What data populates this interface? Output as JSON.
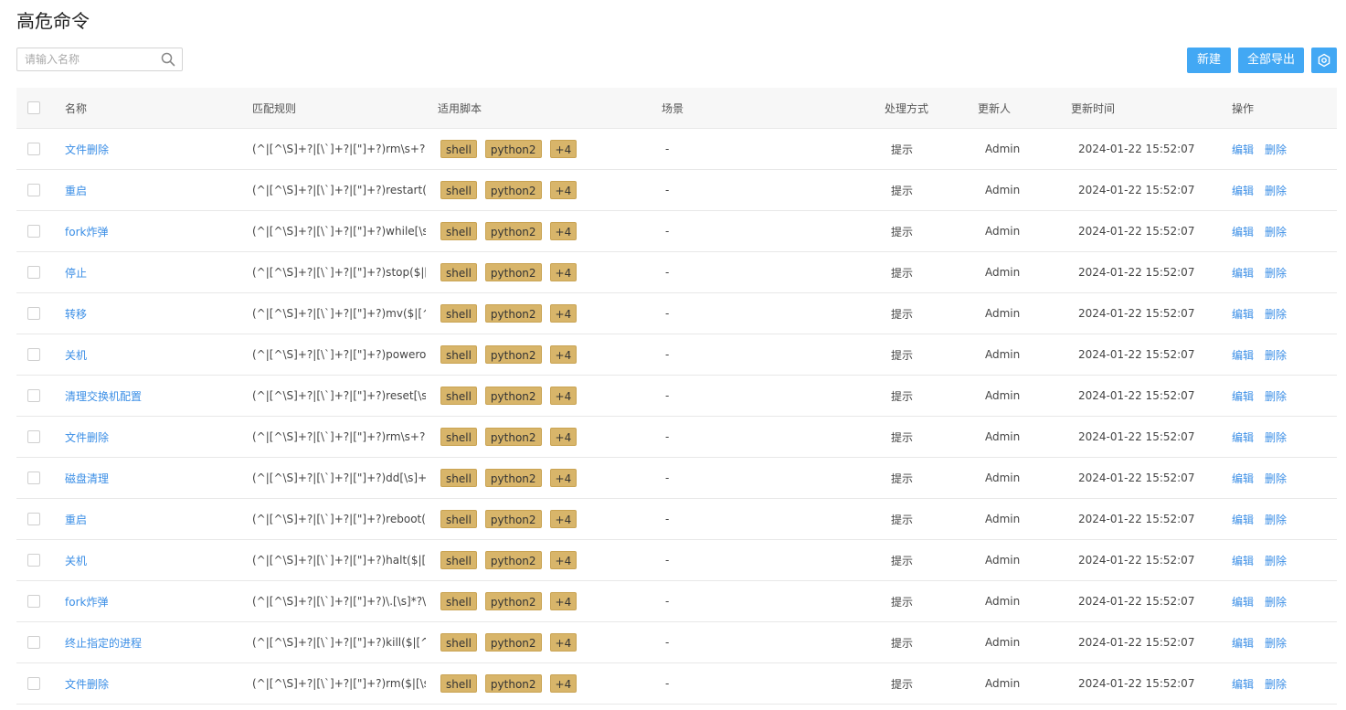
{
  "page": {
    "title": "高危命令"
  },
  "search": {
    "placeholder": "请输入名称"
  },
  "toolbar": {
    "new_label": "新建",
    "export_label": "全部导出",
    "settings_icon": "settings-icon"
  },
  "table": {
    "columns": [
      "名称",
      "匹配规则",
      "适用脚本",
      "场景",
      "处理方式",
      "更新人",
      "更新时间",
      "操作"
    ],
    "ops": {
      "edit": "编辑",
      "delete": "删除"
    },
    "rows": [
      {
        "name": "文件删除",
        "rule": "(^|[^\\S]+?|[\\`]+?|[\"]+?)rm\\s+?-[rf...",
        "tags": [
          "shell",
          "python2",
          "+4"
        ],
        "scene": "-",
        "handle": "提示",
        "user": "Admin",
        "time": "2024-01-22 15:52:07"
      },
      {
        "name": "重启",
        "rule": "(^|[^\\S]+?|[\\`]+?|[\"]+?)restart($|[...",
        "tags": [
          "shell",
          "python2",
          "+4"
        ],
        "scene": "-",
        "handle": "提示",
        "user": "Admin",
        "time": "2024-01-22 15:52:07"
      },
      {
        "name": "fork炸弹",
        "rule": "(^|[^\\S]+?|[\\`]+?|[\"]+?)while[\\s]*?...",
        "tags": [
          "shell",
          "python2",
          "+4"
        ],
        "scene": "-",
        "handle": "提示",
        "user": "Admin",
        "time": "2024-01-22 15:52:07"
      },
      {
        "name": "停止",
        "rule": "(^|[^\\S]+?|[\\`]+?|[\"]+?)stop($|[^\\...",
        "tags": [
          "shell",
          "python2",
          "+4"
        ],
        "scene": "-",
        "handle": "提示",
        "user": "Admin",
        "time": "2024-01-22 15:52:07"
      },
      {
        "name": "转移",
        "rule": "(^|[^\\S]+?|[\\`]+?|[\"]+?)mv($|[^\\S...",
        "tags": [
          "shell",
          "python2",
          "+4"
        ],
        "scene": "-",
        "handle": "提示",
        "user": "Admin",
        "time": "2024-01-22 15:52:07"
      },
      {
        "name": "关机",
        "rule": "(^|[^\\S]+?|[\\`]+?|[\"]+?)poweroff(...",
        "tags": [
          "shell",
          "python2",
          "+4"
        ],
        "scene": "-",
        "handle": "提示",
        "user": "Admin",
        "time": "2024-01-22 15:52:07"
      },
      {
        "name": "清理交换机配置",
        "rule": "(^|[^\\S]+?|[\\`]+?|[\"]+?)reset[\\s]+...",
        "tags": [
          "shell",
          "python2",
          "+4"
        ],
        "scene": "-",
        "handle": "提示",
        "user": "Admin",
        "time": "2024-01-22 15:52:07"
      },
      {
        "name": "文件删除",
        "rule": "(^|[^\\S]+?|[\\`]+?|[\"]+?)rm\\s+?-[fr...",
        "tags": [
          "shell",
          "python2",
          "+4"
        ],
        "scene": "-",
        "handle": "提示",
        "user": "Admin",
        "time": "2024-01-22 15:52:07"
      },
      {
        "name": "磁盘清理",
        "rule": "(^|[^\\S]+?|[\\`]+?|[\"]+?)dd[\\s]+?.*...",
        "tags": [
          "shell",
          "python2",
          "+4"
        ],
        "scene": "-",
        "handle": "提示",
        "user": "Admin",
        "time": "2024-01-22 15:52:07"
      },
      {
        "name": "重启",
        "rule": "(^|[^\\S]+?|[\\`]+?|[\"]+?)reboot($|[...",
        "tags": [
          "shell",
          "python2",
          "+4"
        ],
        "scene": "-",
        "handle": "提示",
        "user": "Admin",
        "time": "2024-01-22 15:52:07"
      },
      {
        "name": "关机",
        "rule": "(^|[^\\S]+?|[\\`]+?|[\"]+?)halt($|[^\\...",
        "tags": [
          "shell",
          "python2",
          "+4"
        ],
        "scene": "-",
        "handle": "提示",
        "user": "Admin",
        "time": "2024-01-22 15:52:07"
      },
      {
        "name": "fork炸弹",
        "rule": "(^|[^\\S]+?|[\\`]+?|[\"]+?)\\.[\\s]*?\\([\\...",
        "tags": [
          "shell",
          "python2",
          "+4"
        ],
        "scene": "-",
        "handle": "提示",
        "user": "Admin",
        "time": "2024-01-22 15:52:07"
      },
      {
        "name": "终止指定的进程",
        "rule": "(^|[^\\S]+?|[\\`]+?|[\"]+?)kill($|[^\\S]...",
        "tags": [
          "shell",
          "python2",
          "+4"
        ],
        "scene": "-",
        "handle": "提示",
        "user": "Admin",
        "time": "2024-01-22 15:52:07"
      },
      {
        "name": "文件删除",
        "rule": "(^|[^\\S]+?|[\\`]+?|[\"]+?)rm($|[\\s]+...",
        "tags": [
          "shell",
          "python2",
          "+4"
        ],
        "scene": "-",
        "handle": "提示",
        "user": "Admin",
        "time": "2024-01-22 15:52:07"
      }
    ]
  }
}
